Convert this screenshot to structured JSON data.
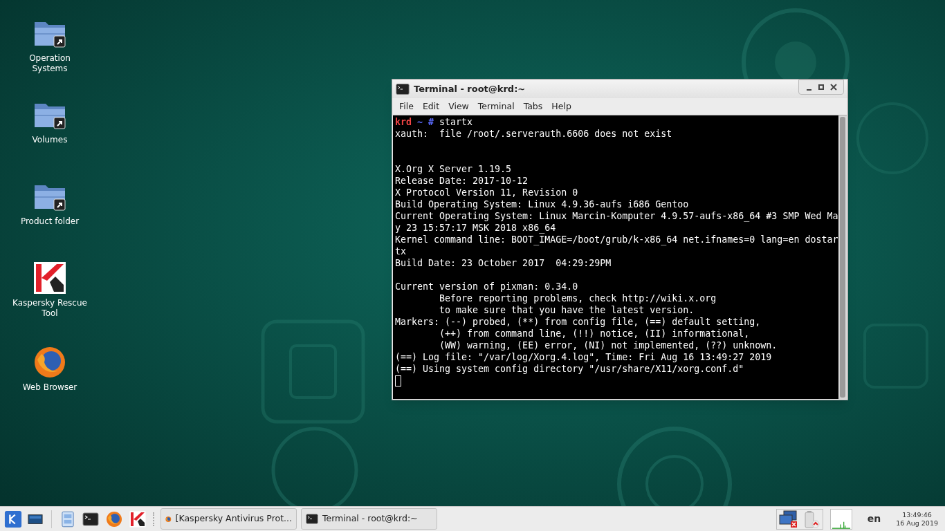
{
  "desktop_icons": [
    {
      "kind": "folder",
      "label": "Operation Systems"
    },
    {
      "kind": "folder",
      "label": "Volumes"
    },
    {
      "kind": "folder",
      "label": "Product folder"
    },
    {
      "kind": "kaspersky",
      "label": "Kaspersky Rescue Tool"
    },
    {
      "kind": "browser",
      "label": "Web Browser"
    }
  ],
  "window": {
    "title": "Terminal - root@krd:~",
    "menu": [
      "File",
      "Edit",
      "View",
      "Terminal",
      "Tabs",
      "Help"
    ],
    "prompt": {
      "host": "krd",
      "path": "~",
      "symbol": "#",
      "command": "startx"
    },
    "lines": [
      {
        "text": "xauth:  file /root/.serverauth.6606 does not exist"
      },
      {
        "kind": "blank"
      },
      {
        "kind": "blank"
      },
      {
        "text": "X.Org X Server 1.19.5"
      },
      {
        "text": "Release Date: 2017-10-12"
      },
      {
        "text": "X Protocol Version 11, Revision 0"
      },
      {
        "text": "Build Operating System: Linux 4.9.36-aufs i686 Gentoo"
      },
      {
        "text": "Current Operating System: Linux Marcin-Komputer 4.9.57-aufs-x86_64 #3 SMP Wed Ma"
      },
      {
        "text": "y 23 15:57:17 MSK 2018 x86_64"
      },
      {
        "text": "Kernel command line: BOOT_IMAGE=/boot/grub/k-x86_64 net.ifnames=0 lang=en dostar"
      },
      {
        "text": "tx"
      },
      {
        "text": "Build Date: 23 October 2017  04:29:29PM"
      },
      {
        "kind": "blank"
      },
      {
        "text": "Current version of pixman: 0.34.0"
      },
      {
        "text": "        Before reporting problems, check http://wiki.x.org"
      },
      {
        "text": "        to make sure that you have the latest version."
      },
      {
        "text": "Markers: (--) probed, (**) from config file, (==) default setting,"
      },
      {
        "text": "        (++) from command line, (!!) notice, (II) informational,"
      },
      {
        "text": "        (WW) warning, (EE) error, (NI) not implemented, (??) unknown."
      },
      {
        "text": "(==) Log file: \"/var/log/Xorg.4.log\", Time: Fri Aug 16 13:49:27 2019"
      },
      {
        "text": "(==) Using system config directory \"/usr/share/X11/xorg.conf.d\""
      }
    ]
  },
  "taskbar": {
    "launchers": [
      {
        "kind": "kde"
      },
      {
        "kind": "desktop"
      },
      {
        "kind": "separator"
      },
      {
        "kind": "files"
      },
      {
        "kind": "terminal"
      },
      {
        "kind": "browser"
      },
      {
        "kind": "kaspersky"
      }
    ],
    "tasks": [
      {
        "kind": "browser",
        "label": "[Kaspersky Antivirus Prot..."
      },
      {
        "kind": "terminal",
        "label": "Terminal - root@krd:~"
      }
    ],
    "language": "en",
    "time": "13:49:46",
    "date": "16 Aug 2019"
  }
}
